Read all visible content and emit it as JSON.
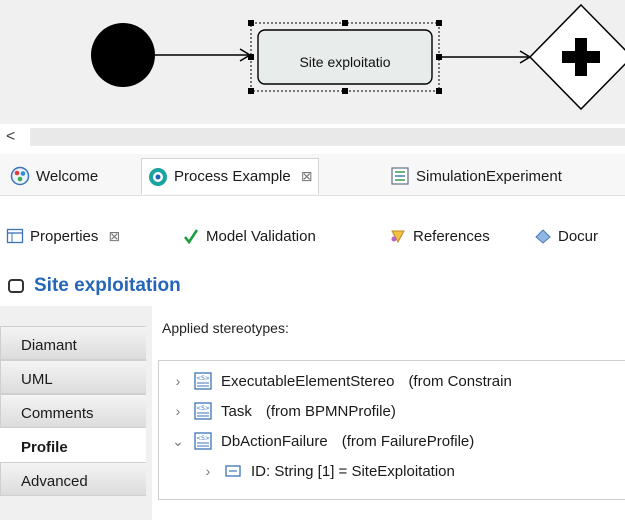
{
  "diagram": {
    "task_label": "Site exploitatio"
  },
  "editor_tabs": [
    {
      "label": "Welcome",
      "icon": "welcome-icon"
    },
    {
      "label": "Process Example",
      "icon": "process-icon",
      "close": "⊠"
    },
    {
      "label": "SimulationExperiment",
      "icon": "simulation-icon"
    }
  ],
  "view_tabs": [
    {
      "label": "Properties",
      "icon": "properties-icon",
      "close": "⊠"
    },
    {
      "label": "Model Validation",
      "icon": "check-icon"
    },
    {
      "label": "References",
      "icon": "references-icon"
    },
    {
      "label": "Docur",
      "icon": "documentation-icon"
    }
  ],
  "selection": {
    "title": "Site exploitation"
  },
  "property_tabs": [
    "Diamant",
    "UML",
    "Comments",
    "Profile",
    "Advanced"
  ],
  "active_property_tab": "Profile",
  "profile": {
    "applied_label": "Applied stereotypes:",
    "stereotypes": [
      {
        "name": "ExecutableElementStereo",
        "from": "(from Constrain",
        "expanded": false
      },
      {
        "name": "Task",
        "from": "(from BPMNProfile)",
        "expanded": false
      },
      {
        "name": "DbActionFailure",
        "from": "(from FailureProfile)",
        "expanded": true
      }
    ],
    "attribute": "ID: String [1] = SiteExploitation"
  },
  "colors": {
    "title": "#2466b8",
    "canvas": "#f0f0f0",
    "check": "#1e9e3e"
  }
}
